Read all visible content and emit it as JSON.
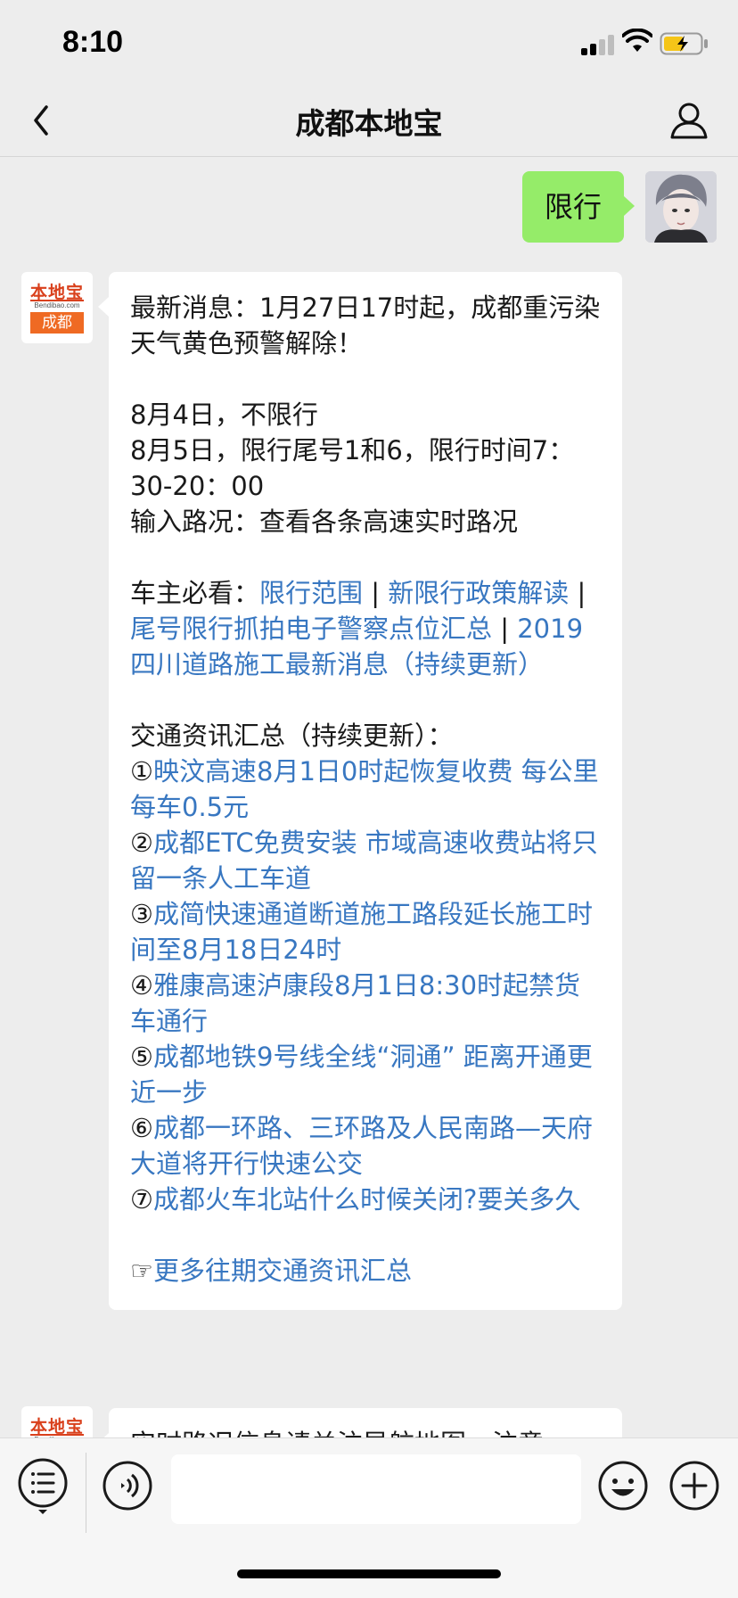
{
  "status_bar": {
    "time": "8:10"
  },
  "nav": {
    "title": "成都本地宝"
  },
  "chat": {
    "user_message": "限行",
    "bot_avatar": {
      "top_text": "本地宝",
      "mid_text": "Bendibao.com",
      "bottom_text": "成都"
    },
    "bot_message": {
      "headline": "最新消息：1月27日17时起，成都重污染天气黄色预警解除！",
      "lines": [
        "8月4日，不限行",
        "8月5日，限行尾号1和6，限行时间7：30-20：00",
        "输入路况：查看各条高速实时路况"
      ],
      "must_see_label": "车主必看：",
      "must_see_links": [
        "限行范围",
        "新限行政策解读",
        "尾号限行抓拍电子警察点位汇总",
        "2019四川道路施工最新消息（持续更新）"
      ],
      "separator": " | ",
      "summary_title": "交通资讯汇总（持续更新）：",
      "summary_items": [
        {
          "num": "①",
          "text": "映汶高速8月1日0时起恢复收费 每公里每车0.5元"
        },
        {
          "num": "②",
          "text": "成都ETC免费安装 市域高速收费站将只留一条人工车道"
        },
        {
          "num": "③",
          "text": "成简快速通道断道施工路段延长施工时间至8月18日24时"
        },
        {
          "num": "④",
          "text": "雅康高速泸康段8月1日8:30时起禁货车通行"
        },
        {
          "num": "⑤",
          "text": "成都地铁9号线全线“洞通” 距离开通更近一步"
        },
        {
          "num": "⑥",
          "text": "成都一环路、三环路及人民南路—天府大道将开行快速公交"
        },
        {
          "num": "⑦",
          "text": "成都火车北站什么时候关闭?要关多久"
        }
      ],
      "more_prefix": "☞",
      "more_link": "更多往期交通资讯汇总"
    },
    "next_message_partial": "实时路况信息请关注导航地图，注意"
  },
  "input_bar": {
    "placeholder": ""
  },
  "colors": {
    "link": "#3877c1",
    "my_bubble": "#95ec69",
    "background": "#ededed"
  },
  "icons": [
    "back-icon",
    "profile-icon",
    "menu-icon",
    "voice-icon",
    "emoji-icon",
    "plus-icon",
    "signal-icon",
    "wifi-icon",
    "battery-icon"
  ]
}
